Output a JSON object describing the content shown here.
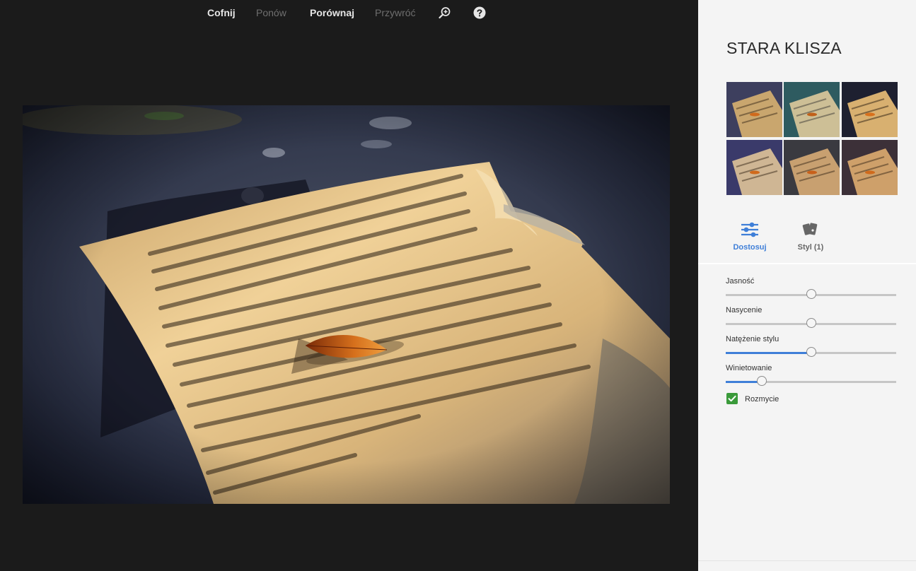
{
  "toolbar": {
    "undo": "Cofnij",
    "redo": "Ponów",
    "compare": "Porównaj",
    "restore": "Przywróć",
    "zoom_icon": "zoom-in-icon",
    "help_icon": "help-icon"
  },
  "panel": {
    "title": "STARA KLISZA",
    "tabs": [
      {
        "label": "Dostosuj",
        "icon": "sliders-icon",
        "active": true
      },
      {
        "label": "Styl (1)",
        "icon": "cards-icon",
        "active": false
      }
    ],
    "sliders": [
      {
        "label": "Jasność",
        "value": 0.5,
        "filled": false
      },
      {
        "label": "Nasycenie",
        "value": 0.5,
        "filled": false
      },
      {
        "label": "Natężenie stylu",
        "value": 0.5,
        "filled": true
      },
      {
        "label": "Winietowanie",
        "value": 0.21,
        "filled": true
      }
    ],
    "blur": {
      "label": "Rozmycie",
      "checked": true
    }
  },
  "colors": {
    "accent": "#3f7fd8",
    "checkbox": "#3a9a3a"
  }
}
